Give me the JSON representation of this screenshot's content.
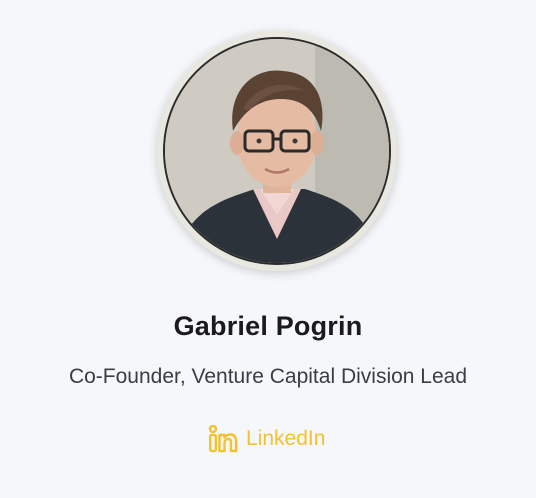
{
  "profile": {
    "name": "Gabriel Pogrin",
    "role": "Co-Founder, Venture Capital Division Lead",
    "link_label": "LinkedIn",
    "link_icon": "linkedin-icon",
    "accent_color": "#f2c230"
  }
}
